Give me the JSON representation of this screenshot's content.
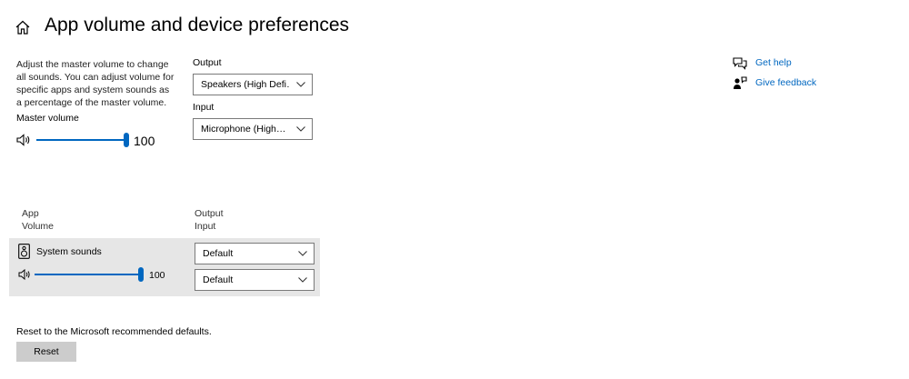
{
  "header": {
    "title": "App volume and device preferences",
    "home_icon": "home-icon"
  },
  "description": "Adjust the master volume to change all sounds. You can adjust volume for specific apps and system sounds as a percentage of the master volume.",
  "master": {
    "label": "Master volume",
    "value": "100",
    "level": 1.0
  },
  "output": {
    "label": "Output",
    "selected": "Speakers (High Defi…"
  },
  "input": {
    "label": "Input",
    "selected": "Microphone (High…"
  },
  "app_table": {
    "app_header": "App",
    "volume_header": "Volume",
    "output_header": "Output",
    "input_header": "Input",
    "rows": [
      {
        "name": "System sounds",
        "value": "100",
        "level": 1.0,
        "output": "Default",
        "input": "Default"
      }
    ]
  },
  "reset": {
    "text": "Reset to the Microsoft recommended defaults.",
    "button": "Reset"
  },
  "links": {
    "help": "Get help",
    "feedback": "Give feedback"
  },
  "colors": {
    "accent": "#0067c0",
    "row_bg": "#e6e6e6",
    "button_bg": "#cccccc"
  }
}
